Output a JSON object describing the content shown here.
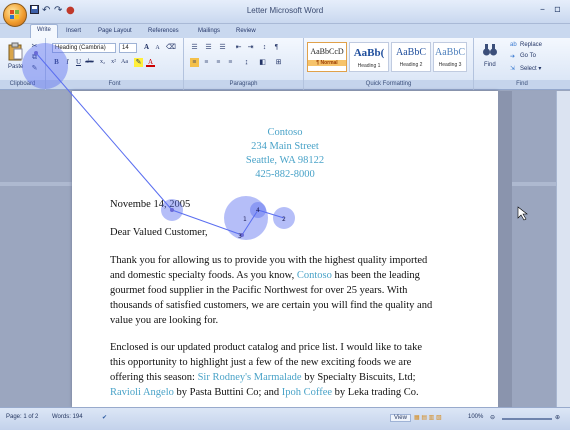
{
  "window": {
    "title": "Letter  Microsoft Word"
  },
  "qat": {
    "save": "save-icon",
    "undo": "↶",
    "redo": "↷"
  },
  "tabs": [
    "Write",
    "Insert",
    "Page Layout",
    "References",
    "Mailings",
    "Review"
  ],
  "active_tab": "Write",
  "ribbon": {
    "clipboard": {
      "label": "Clipboard",
      "paste": "Paste"
    },
    "font": {
      "label": "Font",
      "name": "Heading (Cambria)",
      "size": "14",
      "grow": "A",
      "shrink": "A"
    },
    "paragraph": {
      "label": "Paragraph"
    },
    "styles": {
      "label": "Quick Formatting",
      "items": [
        {
          "sample": "AaBbCcD",
          "name": "¶ Normal"
        },
        {
          "sample": "AaBb(",
          "name": "Heading 1"
        },
        {
          "sample": "AaBbC",
          "name": "Heading 2"
        },
        {
          "sample": "AaBbC",
          "name": "Heading 3"
        }
      ]
    },
    "editing": {
      "label": "Find",
      "find": "Find",
      "replace": "Replace",
      "goto": "Go To",
      "select": "Select ▾"
    }
  },
  "document": {
    "sender": [
      "Contoso",
      "234 Main Street",
      "Seattle, WA 98122",
      "425-882-8000"
    ],
    "date": "Novembe 14, 2005",
    "salutation": "Dear Valued Customer,",
    "para1": {
      "line1": "Thank you for allowing us to provide you with the highest quality imported",
      "line2a": "and domestic specialty foods.  As you know, ",
      "line2link": "Contoso",
      "line2b": " has been the leading",
      "line3": "gourmet food supplier in the Pacific Northwest for over 25 years.  With",
      "line4": "thousands of satisfied customers, we are certain you will find the quality and",
      "line5": "value you are looking for."
    },
    "para2": {
      "line1": "Enclosed is our updated product catalog and price list.  I would like to take",
      "line2": "this opportunity to highlight just a few of the new exciting foods we are",
      "line3a": "offering this season: ",
      "line3link": "Sir Rodney's Marmalade",
      "line3b": " by Specialty Biscuits, Ltd;",
      "line4link1": "Ravioli Angelo",
      "line4a": " by Pasta Buttini Co; and ",
      "line4link2": "Ipoh Coffee",
      "line4b": " by Leka trading Co."
    }
  },
  "status": {
    "page": "Page: 1 of 2",
    "words": "Words: 194",
    "view": "View",
    "zoom": "100%"
  },
  "touch_numbers": [
    "1",
    "2",
    "3",
    "4"
  ],
  "colors": {
    "link": "#4aa3c8",
    "touch": "#5a6ef0"
  }
}
